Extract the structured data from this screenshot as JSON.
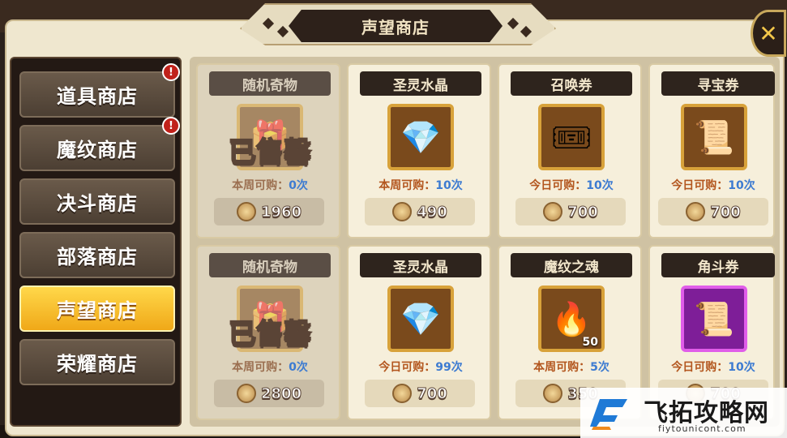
{
  "title": "声望商店",
  "close_icon": "crossed-swords-close-icon",
  "sidebar": {
    "items": [
      {
        "label": "道具商店",
        "badge": "!",
        "active": false
      },
      {
        "label": "魔纹商店",
        "badge": "!",
        "active": false
      },
      {
        "label": "决斗商店",
        "badge": "",
        "active": false
      },
      {
        "label": "部落商店",
        "badge": "",
        "active": false
      },
      {
        "label": "声望商店",
        "badge": "",
        "active": true
      },
      {
        "label": "荣耀商店",
        "badge": "",
        "active": false
      }
    ]
  },
  "sold_out_label": "已售罄",
  "items": [
    {
      "name": "随机奇物",
      "icon": "gift-box-icon",
      "sold": true,
      "limit_label": "本周可购：",
      "limit_count": "0次",
      "price": "1960",
      "qty": ""
    },
    {
      "name": "圣灵水晶",
      "icon": "red-crystal-icon",
      "sold": false,
      "limit_label": "本周可购：",
      "limit_count": "10次",
      "price": "490",
      "qty": ""
    },
    {
      "name": "召唤券",
      "icon": "summon-ticket-icon",
      "sold": false,
      "limit_label": "今日可购：",
      "limit_count": "10次",
      "price": "700",
      "qty": ""
    },
    {
      "name": "寻宝券",
      "icon": "treasure-scroll-icon",
      "sold": false,
      "limit_label": "今日可购：",
      "limit_count": "10次",
      "price": "700",
      "qty": ""
    },
    {
      "name": "随机奇物",
      "icon": "gift-box-icon",
      "sold": true,
      "limit_label": "本周可购：",
      "limit_count": "0次",
      "price": "2800",
      "qty": ""
    },
    {
      "name": "圣灵水晶",
      "icon": "red-crystal-icon",
      "sold": false,
      "limit_label": "今日可购：",
      "limit_count": "99次",
      "price": "700",
      "qty": ""
    },
    {
      "name": "魔纹之魂",
      "icon": "fire-soul-icon",
      "sold": false,
      "limit_label": "本周可购：",
      "limit_count": "5次",
      "price": "350",
      "qty": "50"
    },
    {
      "name": "角斗券",
      "icon": "pk-scroll-icon",
      "sold": false,
      "limit_label": "今日可购：",
      "limit_count": "10次",
      "price": "700",
      "qty": ""
    }
  ],
  "currency_icon": "reputation-coin-icon",
  "watermark": {
    "text": "飞拓攻略网",
    "url": "fiytounicont.com"
  }
}
